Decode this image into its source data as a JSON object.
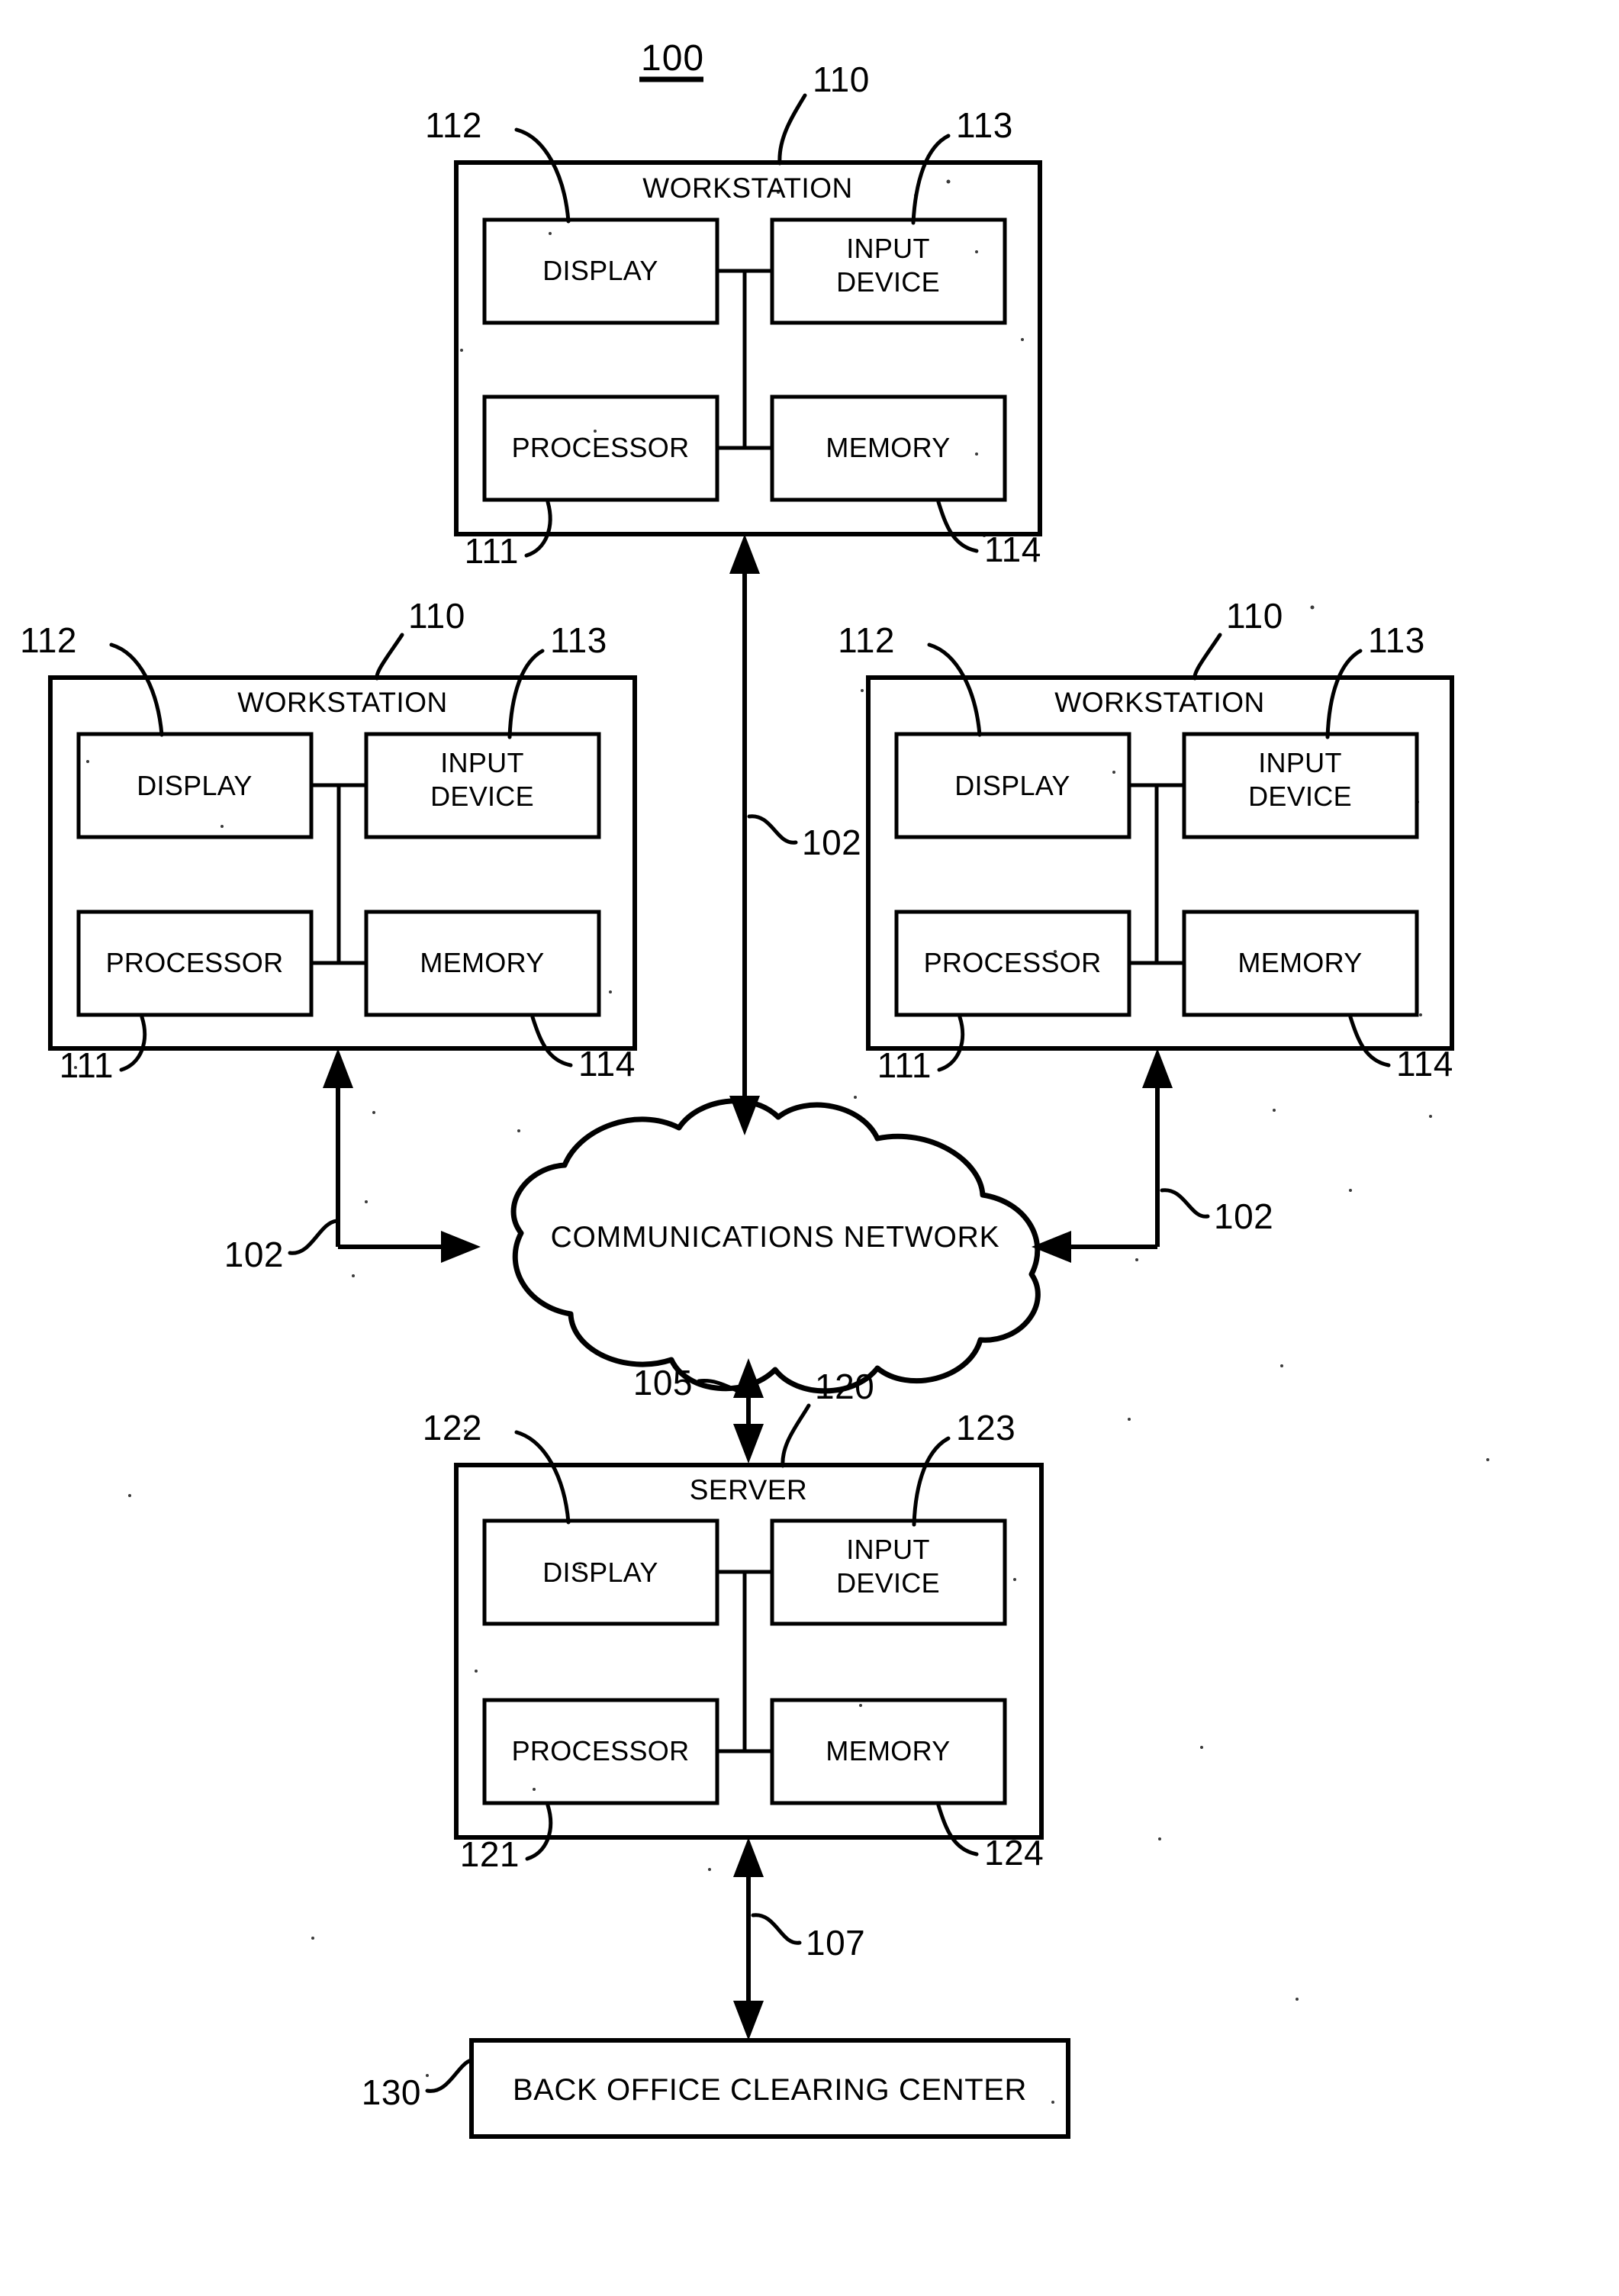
{
  "figure": {
    "number": "100",
    "underlined": true
  },
  "nodes": {
    "workstation_label": "WORKSTATION",
    "server_label": "SERVER",
    "display_label": "DISPLAY",
    "input_device_label_line1": "INPUT",
    "input_device_label_line2": "DEVICE",
    "processor_label": "PROCESSOR",
    "memory_label": "MEMORY",
    "network_label": "COMMUNICATIONS NETWORK",
    "back_office_label": "BACK OFFICE CLEARING CENTER"
  },
  "workstations": [
    {
      "id": "workstation-top",
      "title": "WORKSTATION",
      "refs": {
        "unit": "110",
        "display": "112",
        "input_device": "113",
        "processor": "111",
        "memory": "114"
      }
    },
    {
      "id": "workstation-left",
      "title": "WORKSTATION",
      "refs": {
        "unit": "110",
        "display": "112",
        "input_device": "113",
        "processor": "111",
        "memory": "114"
      }
    },
    {
      "id": "workstation-right",
      "title": "WORKSTATION",
      "refs": {
        "unit": "110",
        "display": "112",
        "input_device": "113",
        "processor": "111",
        "memory": "114"
      }
    }
  ],
  "server": {
    "id": "server",
    "title": "SERVER",
    "refs": {
      "unit": "120",
      "display": "122",
      "input_device": "123",
      "processor": "121",
      "memory": "124"
    }
  },
  "network": {
    "id": "communications-network",
    "title": "COMMUNICATIONS NETWORK",
    "ref": "105"
  },
  "back_office": {
    "id": "back-office-clearing-center",
    "title": "BACK OFFICE CLEARING CENTER",
    "ref": "130"
  },
  "links": [
    {
      "id": "link-top-workstation-to-network",
      "ref": "102"
    },
    {
      "id": "link-left-workstation-to-network",
      "ref": "102"
    },
    {
      "id": "link-right-workstation-to-network",
      "ref": "102"
    },
    {
      "id": "link-network-to-server",
      "ref": "105"
    },
    {
      "id": "link-server-to-back-office",
      "ref": "107"
    }
  ],
  "colors": {
    "ink": "#000000",
    "paper": "#ffffff"
  }
}
